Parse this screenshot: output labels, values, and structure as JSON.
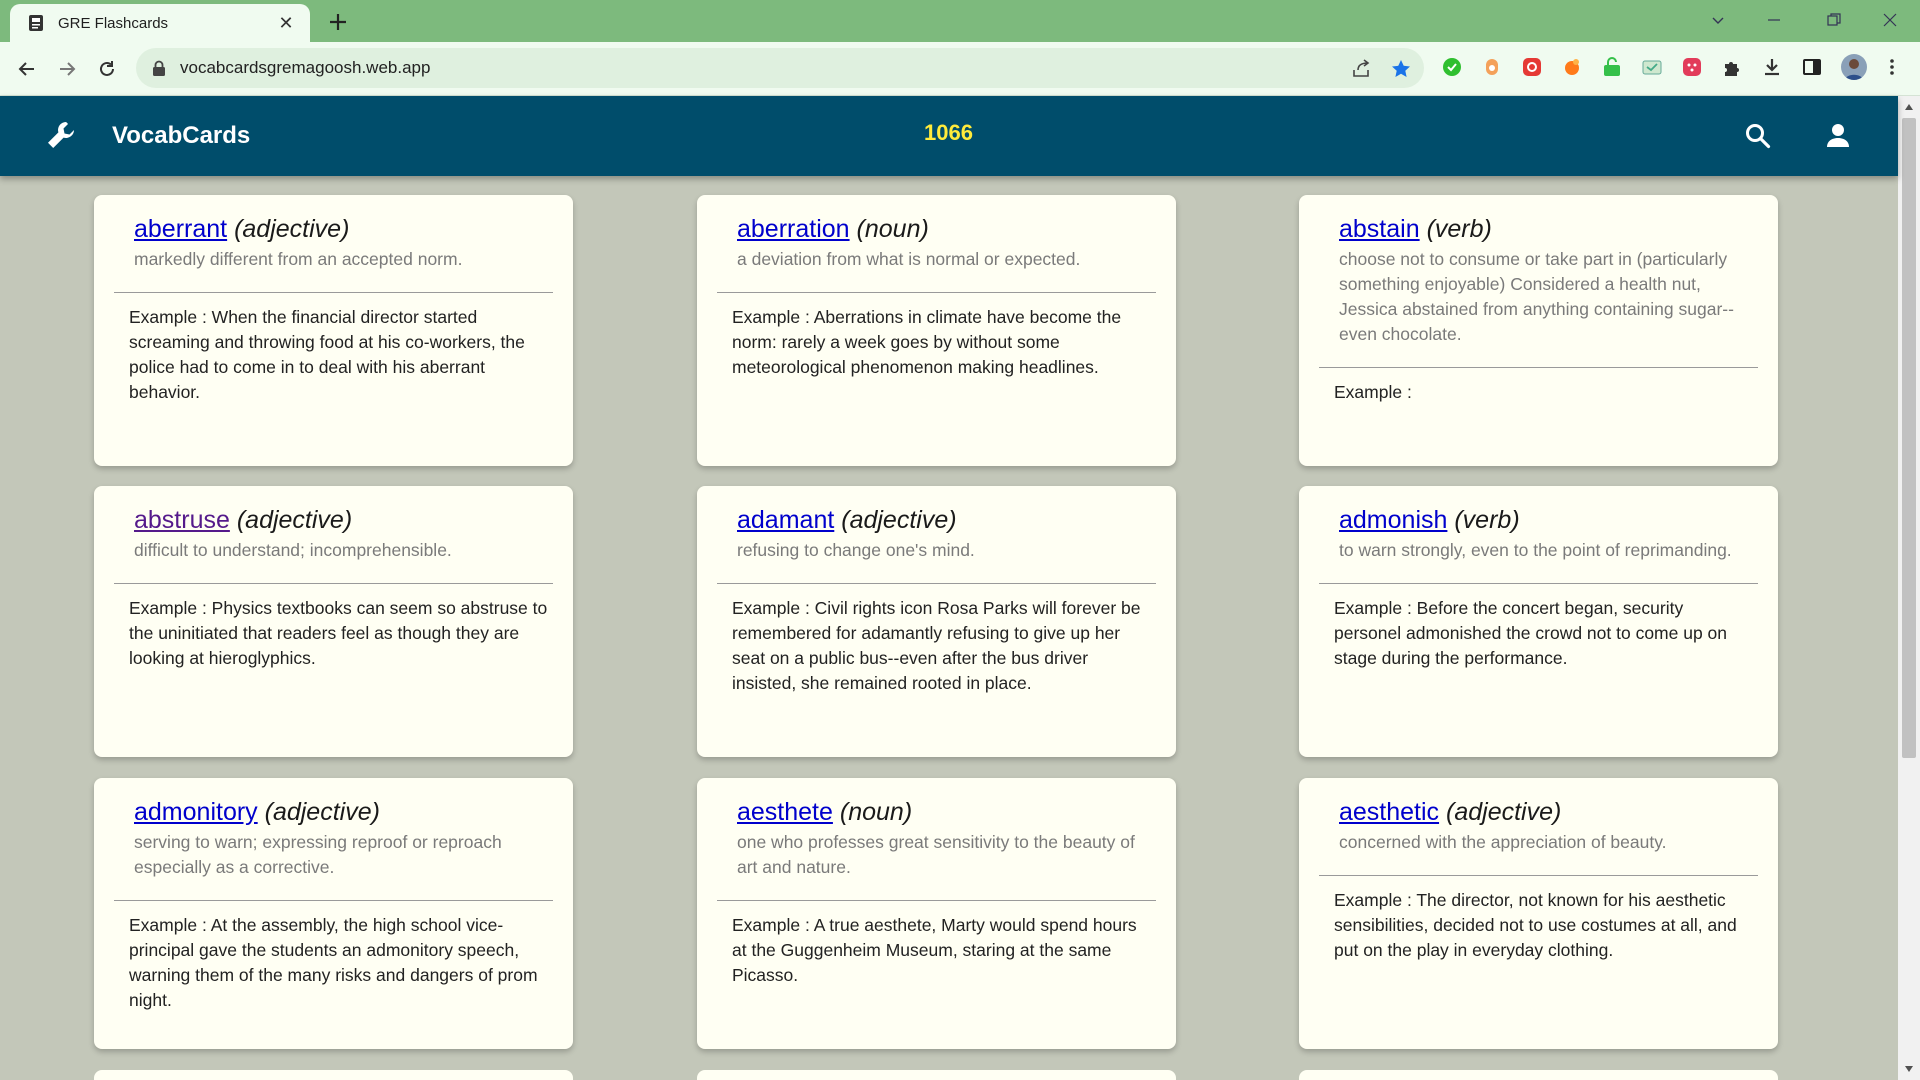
{
  "browser": {
    "tab_title": "GRE Flashcards",
    "url": "vocabcardsgremagoosh.web.app"
  },
  "header": {
    "app_title": "VocabCards",
    "count": "1066"
  },
  "cards": [
    {
      "word": "aberrant",
      "pos": "(adjective)",
      "definition": "markedly different from an accepted norm.",
      "example": "Example : When the financial director started screaming and throwing food at his co-workers, the police had to come in to deal with his aberrant behavior."
    },
    {
      "word": "aberration",
      "pos": "(noun)",
      "definition": "a deviation from what is normal or expected.",
      "example": "Example : Aberrations in climate have become the norm: rarely a week goes by without some meteorological phenomenon making headlines."
    },
    {
      "word": "abstain",
      "pos": "(verb)",
      "definition": "choose not to consume or take part in (particularly something enjoyable) Considered a health nut, Jessica abstained from anything containing sugar--even chocolate.",
      "example": "Example :"
    },
    {
      "word": "abstruse",
      "pos": "(adjective)",
      "definition": "difficult to understand; incomprehensible.",
      "example": "Example : Physics textbooks can seem so abstruse to the uninitiated that readers feel as though they are looking at hieroglyphics."
    },
    {
      "word": "adamant",
      "pos": "(adjective)",
      "definition": "refusing to change one's mind.",
      "example": "Example : Civil rights icon Rosa Parks will forever be remembered for adamantly refusing to give up her seat on a public bus--even after the bus driver insisted, she remained rooted in place."
    },
    {
      "word": "admonish",
      "pos": "(verb)",
      "definition": "to warn strongly, even to the point of reprimanding.",
      "example": "Example : Before the concert began, security personel admonished the crowd not to come up on stage during the performance."
    },
    {
      "word": "admonitory",
      "pos": "(adjective)",
      "definition": "serving to warn; expressing reproof or reproach especially as a corrective.",
      "example": "Example : At the assembly, the high school vice-principal gave the students an admonitory speech, warning them of the many risks and dangers of prom night."
    },
    {
      "word": "aesthete",
      "pos": "(noun)",
      "definition": "one who professes great sensitivity to the beauty of art and nature.",
      "example": "Example : A true aesthete, Marty would spend hours at the Guggenheim Museum, staring at the same Picasso."
    },
    {
      "word": "aesthetic",
      "pos": "(adjective)",
      "definition": "concerned with the appreciation of beauty.",
      "example": "Example : The director, not known for his aesthetic sensibilities, decided not to use costumes at all, and put on the play in everyday clothing."
    }
  ],
  "colors": {
    "header_bg": "#004d6b",
    "count_color": "#ffeb3b",
    "page_bg": "#c3c7b9",
    "card_bg": "#fffff3",
    "link": "#0000cc",
    "visited_link": "#551a8b"
  },
  "icons": [
    "flashcard-favicon-icon",
    "close-icon",
    "plus-icon",
    "back-icon",
    "forward-icon",
    "reload-icon",
    "lock-icon",
    "share-icon",
    "star-icon",
    "wrench-icon",
    "search-icon",
    "user-icon"
  ]
}
